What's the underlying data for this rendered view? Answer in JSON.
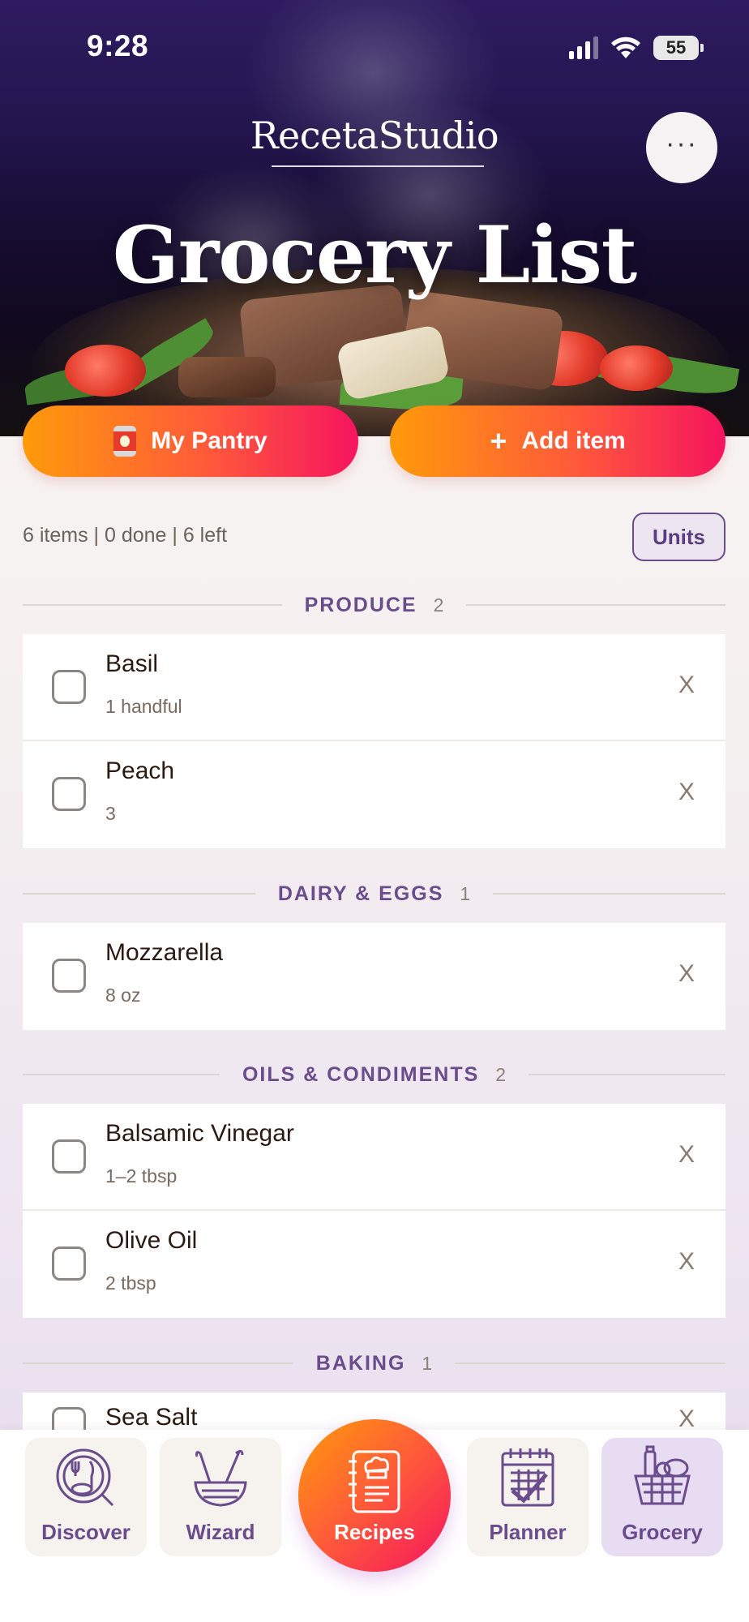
{
  "status_bar": {
    "time": "9:28",
    "battery": "55"
  },
  "header": {
    "brand": "RecetaStudio",
    "title": "Grocery List",
    "more_label": "···"
  },
  "actions": {
    "pantry_label": "My Pantry",
    "add_label": "Add item",
    "add_glyph": "+"
  },
  "summary": {
    "text": "6 items | 0 done | 6 left",
    "units_label": "Units"
  },
  "sections": [
    {
      "name": "PRODUCE",
      "count": "2",
      "items": [
        {
          "name": "Basil",
          "qty": "1 handful"
        },
        {
          "name": "Peach",
          "qty": "3"
        }
      ]
    },
    {
      "name": "DAIRY & EGGS",
      "count": "1",
      "items": [
        {
          "name": "Mozzarella",
          "qty": "8 oz"
        }
      ]
    },
    {
      "name": "OILS & CONDIMENTS",
      "count": "2",
      "items": [
        {
          "name": "Balsamic Vinegar",
          "qty": "1–2 tbsp"
        },
        {
          "name": "Olive Oil",
          "qty": "2 tbsp"
        }
      ]
    },
    {
      "name": "BAKING",
      "count": "1",
      "items": [
        {
          "name": "Sea Salt",
          "qty": ""
        }
      ]
    }
  ],
  "remove_glyph": "X",
  "nav": {
    "discover": "Discover",
    "wizard": "Wizard",
    "recipes": "Recipes",
    "planner": "Planner",
    "grocery": "Grocery",
    "active": "grocery"
  },
  "colors": {
    "accent_purple": "#6a4c8c",
    "gradient_start": "#ff9a0a",
    "gradient_end": "#f5145f",
    "active_tab_bg": "#e8dcf3"
  }
}
